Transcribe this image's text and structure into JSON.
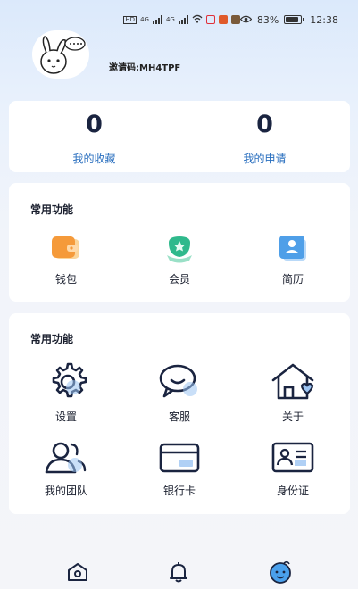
{
  "status_bar": {
    "network_1": "4G",
    "network_2": "4G",
    "battery": "83%",
    "battery_level": 0.83,
    "time": "12:38"
  },
  "profile": {
    "invite_code": "邀请码:MH4TPF"
  },
  "stats": [
    {
      "value": "0",
      "label": "我的收藏"
    },
    {
      "value": "0",
      "label": "我的申请"
    }
  ],
  "common_functions": {
    "title": "常用功能",
    "items": [
      {
        "label": "钱包",
        "icon": "wallet-icon"
      },
      {
        "label": "会员",
        "icon": "vip-icon"
      },
      {
        "label": "简历",
        "icon": "resume-icon"
      }
    ]
  },
  "tools": {
    "title": "常用功能",
    "items": [
      {
        "label": "设置",
        "icon": "gear-icon"
      },
      {
        "label": "客服",
        "icon": "chat-icon"
      },
      {
        "label": "关于",
        "icon": "home-heart-icon"
      },
      {
        "label": "我的团队",
        "icon": "team-icon"
      },
      {
        "label": "银行卡",
        "icon": "bank-card-icon"
      },
      {
        "label": "身份证",
        "icon": "id-card-icon"
      }
    ]
  },
  "tabbar": {
    "tabs": [
      {
        "icon": "home-icon",
        "active": false
      },
      {
        "icon": "bell-icon",
        "active": false
      },
      {
        "icon": "mine-icon",
        "active": true
      }
    ]
  },
  "colors": {
    "accent": "#2a6fbf",
    "navy": "#1a2440",
    "card_bg": "#ffffff"
  }
}
